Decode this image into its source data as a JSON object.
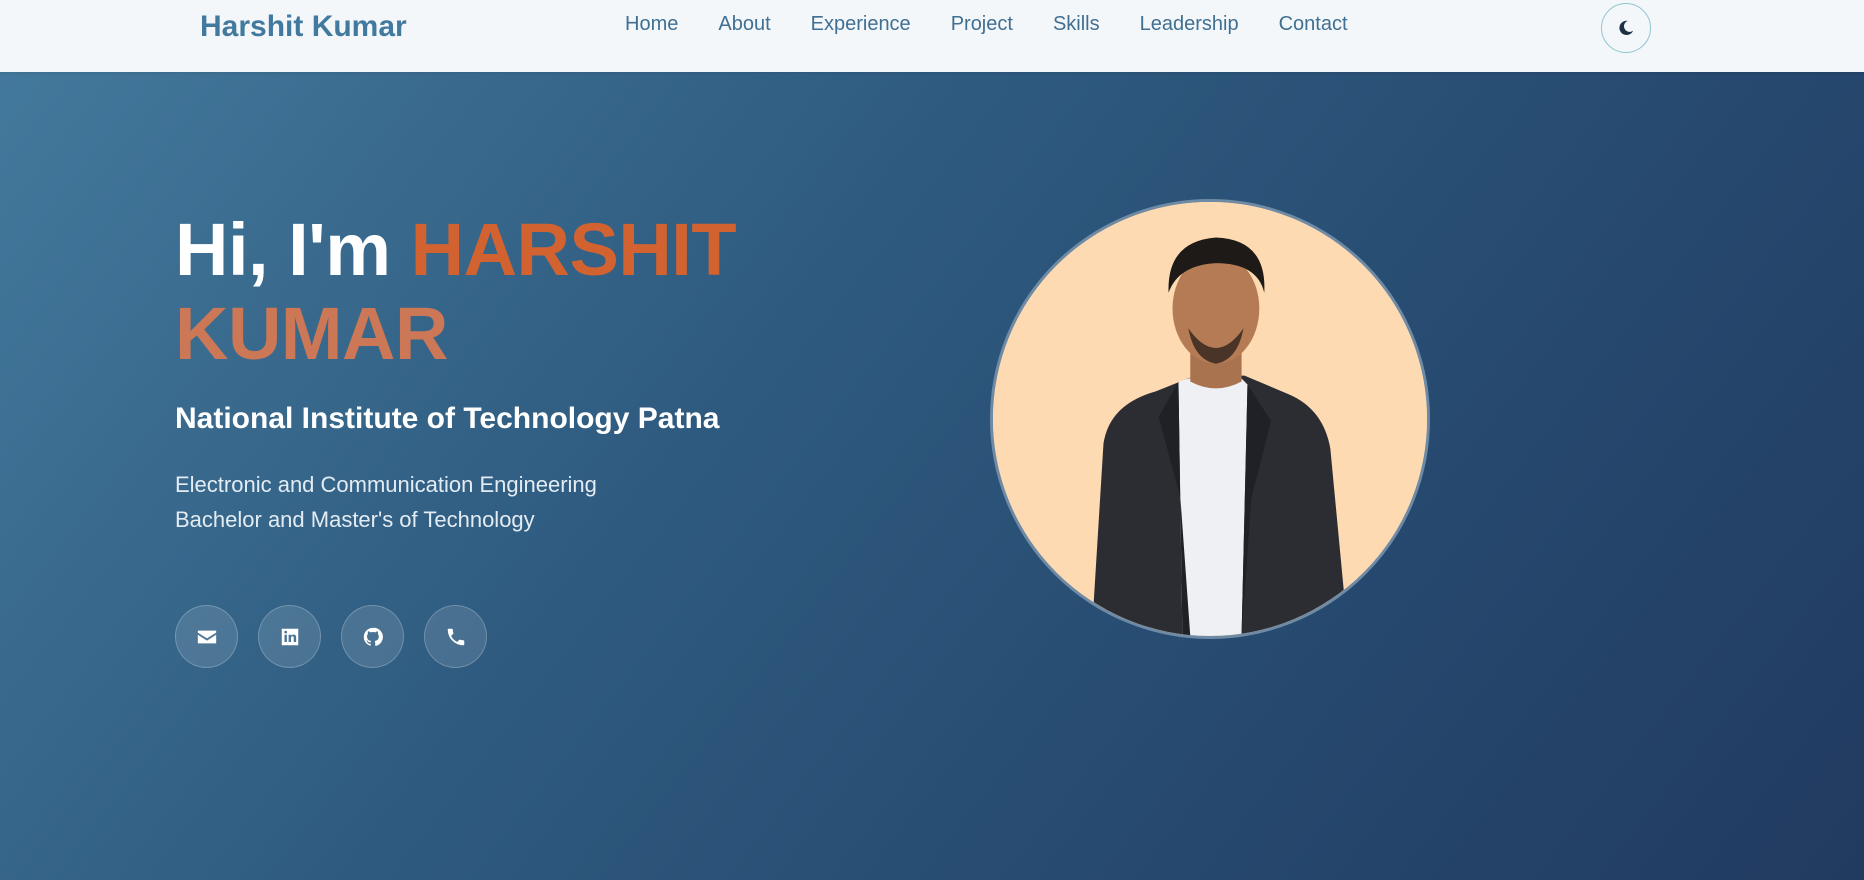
{
  "navbar": {
    "brand": "Harshit Kumar",
    "links": [
      "Home",
      "About",
      "Experience",
      "Project",
      "Skills",
      "Leadership",
      "Contact"
    ],
    "theme_toggle_icon": "moon-icon"
  },
  "hero": {
    "greeting": "Hi, I'm",
    "first_name": "HARSHIT",
    "last_name": "KUMAR",
    "institute": "National Institute of Technology Patna",
    "branch": "Electronic and Communication Engineering",
    "degree": "Bachelor and Master's of Technology",
    "social_icons": [
      "envelope-icon",
      "linkedin-icon",
      "github-icon",
      "phone-icon"
    ],
    "portrait_icon": "profile-photo"
  },
  "colors": {
    "accent_orange": "#d2622f",
    "brand_blue": "#417a9e",
    "hero_gradient_start": "#43799c",
    "hero_gradient_end": "#213a60",
    "photo_background": "#fddab1"
  }
}
